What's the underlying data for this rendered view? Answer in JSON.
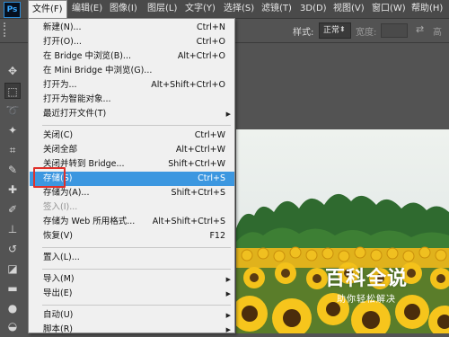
{
  "app": {
    "logo": "Ps"
  },
  "menubar": {
    "items": [
      "文件(F)",
      "编辑(E)",
      "图像(I)",
      "图层(L)",
      "文字(Y)",
      "选择(S)",
      "滤镜(T)",
      "3D(D)",
      "视图(V)",
      "窗口(W)",
      "帮助(H)"
    ]
  },
  "options_bar": {
    "style_label": "样式:",
    "style_value": "正常",
    "width_label": "宽度:",
    "height_label": "高"
  },
  "file_menu": {
    "items": [
      {
        "label": "新建(N)...",
        "shortcut": "Ctrl+N"
      },
      {
        "label": "打开(O)...",
        "shortcut": "Ctrl+O"
      },
      {
        "label": "在 Bridge 中浏览(B)...",
        "shortcut": "Alt+Ctrl+O"
      },
      {
        "label": "在 Mini Bridge 中浏览(G)...",
        "shortcut": ""
      },
      {
        "label": "打开为...",
        "shortcut": "Alt+Shift+Ctrl+O"
      },
      {
        "label": "打开为智能对象...",
        "shortcut": ""
      },
      {
        "label": "最近打开文件(T)",
        "shortcut": ""
      },
      {
        "label": "关闭(C)",
        "shortcut": "Ctrl+W"
      },
      {
        "label": "关闭全部",
        "shortcut": "Alt+Ctrl+W"
      },
      {
        "label": "关闭并转到 Bridge...",
        "shortcut": "Shift+Ctrl+W"
      },
      {
        "label": "存储(S)",
        "shortcut": "Ctrl+S"
      },
      {
        "label": "存储为(A)...",
        "shortcut": "Shift+Ctrl+S"
      },
      {
        "label": "签入(I)...",
        "shortcut": ""
      },
      {
        "label": "存储为 Web 所用格式...",
        "shortcut": "Alt+Shift+Ctrl+S"
      },
      {
        "label": "恢复(V)",
        "shortcut": "F12"
      },
      {
        "label": "置入(L)...",
        "shortcut": ""
      },
      {
        "label": "导入(M)",
        "shortcut": ""
      },
      {
        "label": "导出(E)",
        "shortcut": ""
      },
      {
        "label": "自动(U)",
        "shortcut": ""
      },
      {
        "label": "脚本(R)",
        "shortcut": ""
      }
    ]
  },
  "watermark": {
    "main": "百科全说",
    "sub": "助你轻松解决"
  },
  "colors": {
    "menu_highlight": "#3c97e0",
    "annotation_box": "#e0312b",
    "ui_dark": "#535353"
  }
}
